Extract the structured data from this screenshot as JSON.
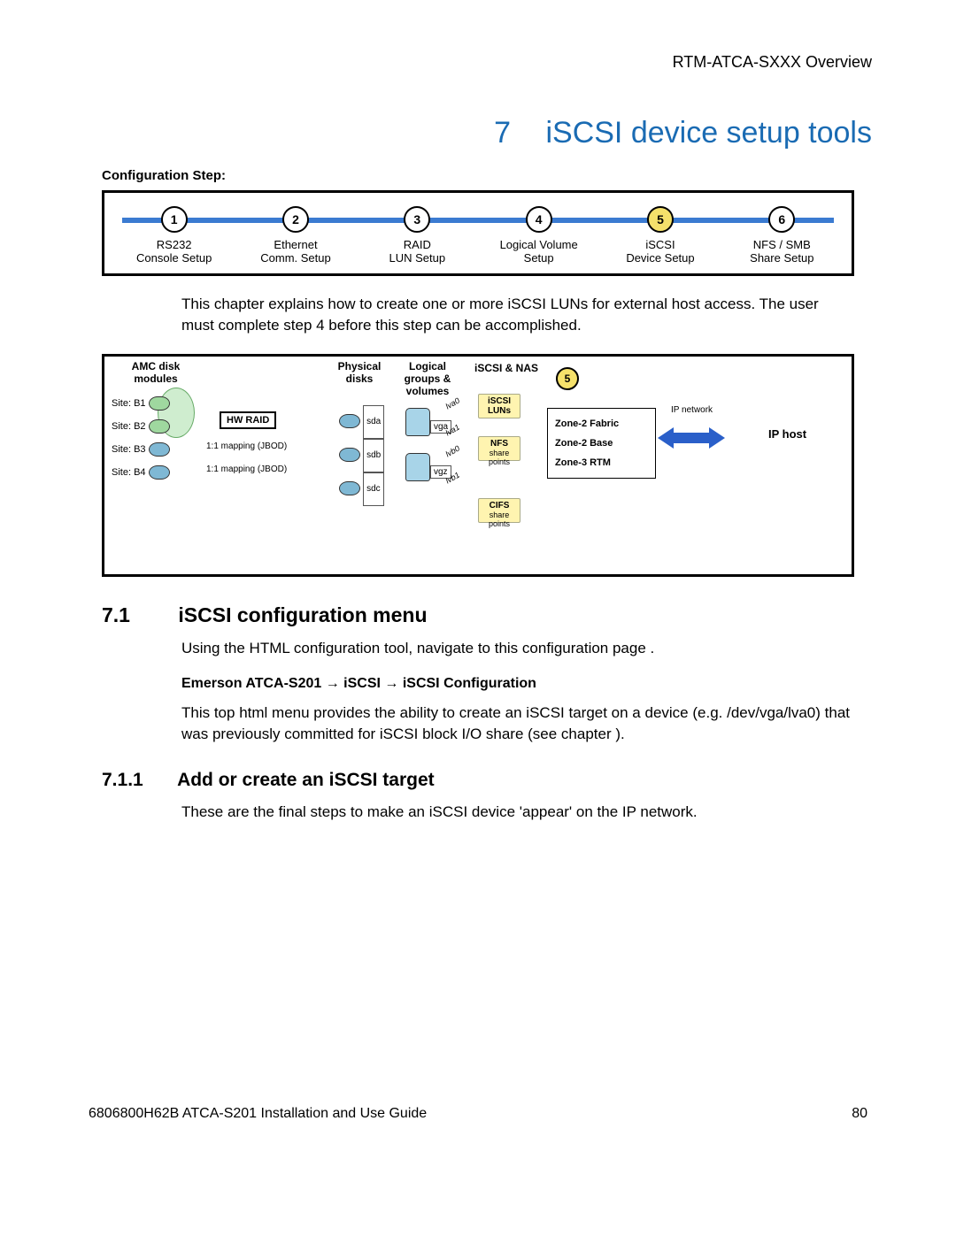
{
  "header": {
    "right": "RTM-ATCA-SXXX Overview"
  },
  "chapter": {
    "num": "7",
    "title": "iSCSI device setup tools"
  },
  "config_step_label": "Configuration Step:",
  "steps": [
    {
      "n": "1",
      "l1": "RS232",
      "l2": "Console Setup"
    },
    {
      "n": "2",
      "l1": "Ethernet",
      "l2": "Comm. Setup"
    },
    {
      "n": "3",
      "l1": "RAID",
      "l2": "LUN Setup"
    },
    {
      "n": "4",
      "l1": "Logical Volume",
      "l2": "Setup"
    },
    {
      "n": "5",
      "l1": "iSCSI",
      "l2": "Device Setup",
      "active": true
    },
    {
      "n": "6",
      "l1": "NFS / SMB",
      "l2": "Share Setup"
    }
  ],
  "intro_para": "This chapter explains how to create one or more iSCSI LUNs for external host access.  The user must complete step 4 before this step can be accomplished.",
  "diagram": {
    "amc_header": "AMC disk modules",
    "sites": [
      "Site: B1",
      "Site: B2",
      "Site: B3",
      "Site: B4"
    ],
    "hwraid": "HW RAID",
    "jbod": "1:1 mapping (JBOD)",
    "phys_header": "Physical disks",
    "phys": [
      "sda",
      "sdb",
      "sdc"
    ],
    "lg_header": "Logical groups & volumes",
    "vg": [
      "vga",
      "vgz"
    ],
    "lv": [
      "lva0",
      "lva1",
      "lvb0",
      "lvb1"
    ],
    "iscsi_header": "iSCSI & NAS",
    "iscsi_luns": "iSCSI LUNs",
    "nfs": "NFS",
    "nfs_sub": "share points",
    "cifs": "CIFS",
    "cifs_sub": "share points",
    "step5": "5",
    "zones": [
      "Zone-2 Fabric",
      "Zone-2 Base",
      "Zone-3 RTM"
    ],
    "ipnet": "IP network",
    "iphost": "IP host"
  },
  "section_71": {
    "num": "7.1",
    "title": "iSCSI configuration menu"
  },
  "para_71a": "Using the HTML configuration tool, navigate to this configuration page .",
  "breadcrumb": "Emerson ATCA-S201 → iSCSI → iSCSI Configuration",
  "para_71b": "This top html menu provides the ability to create an iSCSI target on a device (e.g. /dev/vga/lva0) that was previously committed for iSCSI block I/O share (see chapter ).",
  "section_711": {
    "num": "7.1.1",
    "title": "Add or create an iSCSI target"
  },
  "para_711": "These are the final steps to make an iSCSI device 'appear' on the IP network.",
  "footer": {
    "left": "6806800H62B ATCA-S201 Installation and Use Guide",
    "right": "80"
  }
}
